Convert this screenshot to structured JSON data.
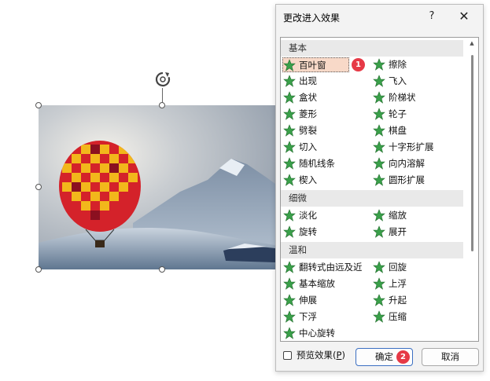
{
  "dialog": {
    "title": "更改进入效果",
    "help_label": "?",
    "close_label": "✕"
  },
  "groups": {
    "basic": "基本",
    "subtle": "细微",
    "moderate": "温和"
  },
  "effects": {
    "basic_left": [
      "百叶窗",
      "出现",
      "盒状",
      "菱形",
      "劈裂",
      "切入",
      "随机线条",
      "楔入"
    ],
    "basic_right": [
      "擦除",
      "飞入",
      "阶梯状",
      "轮子",
      "棋盘",
      "十字形扩展",
      "向内溶解",
      "圆形扩展"
    ],
    "subtle_left": [
      "淡化",
      "旋转"
    ],
    "subtle_right": [
      "缩放",
      "展开"
    ],
    "moderate_left": [
      "翻转式由远及近",
      "基本缩放",
      "伸展",
      "下浮",
      "中心旋转"
    ],
    "moderate_right": [
      "回旋",
      "上浮",
      "升起",
      "压缩"
    ]
  },
  "selected_effect": "百叶窗",
  "badges": [
    "1",
    "2"
  ],
  "preview": {
    "label": "预览效果(",
    "hotkey": "P",
    "label_end": ")",
    "checked": false
  },
  "buttons": {
    "ok": "确定",
    "cancel": "取消"
  },
  "colors": {
    "accent": "#3b6fc2",
    "badge": "#e63946",
    "selection": "#f8d9c8",
    "star": "#3aa04a"
  }
}
